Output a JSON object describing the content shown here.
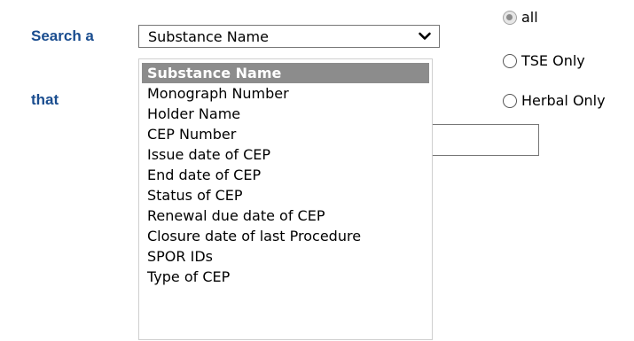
{
  "form": {
    "search_label": "Search a",
    "that_label": "that",
    "select": {
      "selected": "Substance Name",
      "arrow_icon": "chevron-down-icon",
      "options": [
        "Substance Name",
        "Monograph Number",
        "Holder Name",
        "CEP Number",
        "Issue date of CEP",
        "End date of CEP",
        "Status of CEP",
        "Renewal due date of CEP",
        "Closure date of last Procedure",
        "SPOR IDs",
        "Type of CEP"
      ]
    },
    "radios": [
      {
        "label": "all",
        "checked": true
      },
      {
        "label": "TSE Only",
        "checked": false
      },
      {
        "label": "Herbal Only",
        "checked": false
      }
    ],
    "search_value": ""
  },
  "colors": {
    "label_text": "#1a4d8f",
    "highlight": "#8c8c8c"
  }
}
